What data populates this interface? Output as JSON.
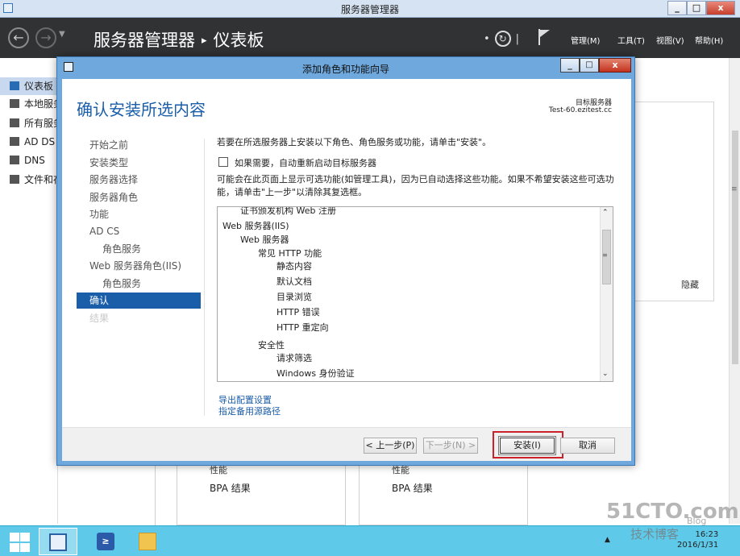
{
  "outer_window": {
    "title": "服务器管理器",
    "minimize": "_",
    "maximize": "□",
    "close": "x"
  },
  "appbar": {
    "breadcrumb_root": "服务器管理器",
    "breadcrumb_separator": "▸",
    "breadcrumb_current": "仪表板",
    "menus": [
      "管理(M)",
      "工具(T)",
      "视图(V)",
      "帮助(H)"
    ],
    "icons": [
      "back-arrow-icon",
      "forward-arrow-icon",
      "refresh-icon",
      "flag-icon"
    ]
  },
  "sidebar": {
    "items": [
      {
        "label": "仪表板",
        "icon": "dashboard-icon",
        "active": true
      },
      {
        "label": "本地服务器",
        "icon": "server-icon"
      },
      {
        "label": "所有服务器",
        "icon": "servers-icon"
      },
      {
        "label": "AD DS",
        "icon": "ad-ds-icon"
      },
      {
        "label": "DNS",
        "icon": "dns-icon"
      },
      {
        "label": "文件和存储服务",
        "icon": "file-storage-icon"
      }
    ]
  },
  "background": {
    "hide_label": "隐藏",
    "tiles": [
      {
        "perf": "性能",
        "bpa": "BPA 结果"
      },
      {
        "perf": "性能",
        "bpa": "BPA 结果"
      }
    ]
  },
  "dialog": {
    "title": "添加角色和功能向导",
    "minimize": "_",
    "maximize": "□",
    "close": "x",
    "heading": "确认安装所选内容",
    "destination_label": "目标服务器",
    "destination_server": "Test-60.ezitest.cc",
    "steps": [
      {
        "label": "开始之前",
        "level": 0
      },
      {
        "label": "安装类型",
        "level": 0
      },
      {
        "label": "服务器选择",
        "level": 0
      },
      {
        "label": "服务器角色",
        "level": 0
      },
      {
        "label": "功能",
        "level": 0
      },
      {
        "label": "AD CS",
        "level": 0
      },
      {
        "label": "角色服务",
        "level": 1
      },
      {
        "label": "Web 服务器角色(IIS)",
        "level": 0
      },
      {
        "label": "角色服务",
        "level": 1
      },
      {
        "label": "确认",
        "level": 0,
        "active": true
      },
      {
        "label": "结果",
        "level": 0,
        "disabled": true
      }
    ],
    "instruction": "若要在所选服务器上安装以下角色、角色服务或功能，请单击\"安装\"。",
    "restart_checkbox_label": "如果需要，自动重新启动目标服务器",
    "restart_checked": false,
    "note_line1": "可能会在此页面上显示可选功能(如管理工具)，因为已自动选择这些功能。如果不希望安装这些可选功",
    "note_line2": "能，请单击\"上一步\"以清除其复选框。",
    "list_items": [
      {
        "text": "证书颁发机构 Web 注册",
        "indent": 1
      },
      {
        "text": "Web 服务器(IIS)",
        "indent": 0
      },
      {
        "text": "Web 服务器",
        "indent": 1
      },
      {
        "text": "常见 HTTP 功能",
        "indent": 2
      },
      {
        "text": "静态内容",
        "indent": 3
      },
      {
        "text": "默认文档",
        "indent": 3
      },
      {
        "text": "目录浏览",
        "indent": 3
      },
      {
        "text": "HTTP 错误",
        "indent": 3
      },
      {
        "text": "HTTP 重定向",
        "indent": 3
      },
      {
        "text": "安全性",
        "indent": 2
      },
      {
        "text": "请求筛选",
        "indent": 3
      },
      {
        "text": "Windows 身份验证",
        "indent": 3
      }
    ],
    "export_link": "导出配置设置",
    "alt_source_link": "指定备用源路径",
    "buttons": {
      "previous": "< 上一步(P)",
      "next": "下一步(N) >",
      "install": "安装(I)",
      "cancel": "取消"
    }
  },
  "taskbar": {
    "items": [
      "start-icon",
      "server-manager-icon",
      "powershell-icon",
      "file-explorer-icon"
    ],
    "powershell_glyph": "≥",
    "tray_arrow": "▲",
    "time": "16:23",
    "date": "2016/1/31"
  },
  "watermark": {
    "site": "51CTO.com",
    "line2": "技术博客",
    "line3": "Blog"
  }
}
